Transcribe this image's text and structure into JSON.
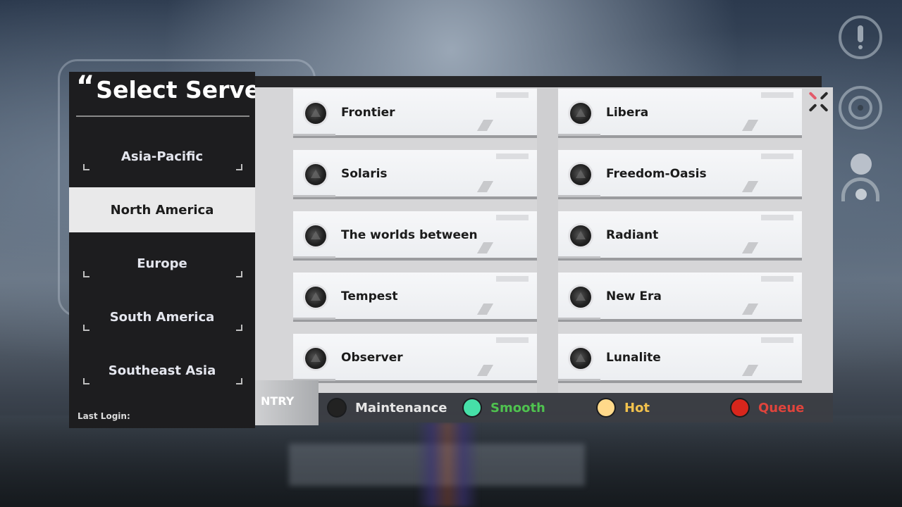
{
  "title": "Select Server",
  "title_quote": "“",
  "regions": [
    {
      "label": "Asia-Pacific",
      "active": false
    },
    {
      "label": "North America",
      "active": true
    },
    {
      "label": "Europe",
      "active": false
    },
    {
      "label": "South America",
      "active": false
    },
    {
      "label": "Southeast Asia",
      "active": false
    }
  ],
  "last_login_label": "Last Login:",
  "servers": [
    {
      "name": "Frontier",
      "status": "maintenance"
    },
    {
      "name": "Libera",
      "status": "maintenance"
    },
    {
      "name": "Solaris",
      "status": "maintenance"
    },
    {
      "name": "Freedom-Oasis",
      "status": "maintenance"
    },
    {
      "name": "The worlds between",
      "status": "maintenance"
    },
    {
      "name": "Radiant",
      "status": "maintenance"
    },
    {
      "name": "Tempest",
      "status": "maintenance"
    },
    {
      "name": "New Era",
      "status": "maintenance"
    },
    {
      "name": "Observer",
      "status": "maintenance"
    },
    {
      "name": "Lunalite",
      "status": "maintenance"
    }
  ],
  "entry_tab_text": "NTRY",
  "legend": [
    {
      "label": "Maintenance",
      "color": "#e6e6e6",
      "dot": "#222222"
    },
    {
      "label": "Smooth",
      "color": "#4fc24f",
      "dot": "#46e0a8"
    },
    {
      "label": "Hot",
      "color": "#f2c24d",
      "dot": "#ffd98a"
    },
    {
      "label": "Queue",
      "color": "#e0443c",
      "dot": "#d8261c"
    }
  ],
  "icons": {
    "close": "close-icon",
    "notice": "notice-icon",
    "settings": "target-icon",
    "account": "user-icon"
  },
  "colors": {
    "accent_close": "#e35a6a",
    "panel_dark": "#1d1d1f",
    "panel_light": "#d6d6d8"
  }
}
